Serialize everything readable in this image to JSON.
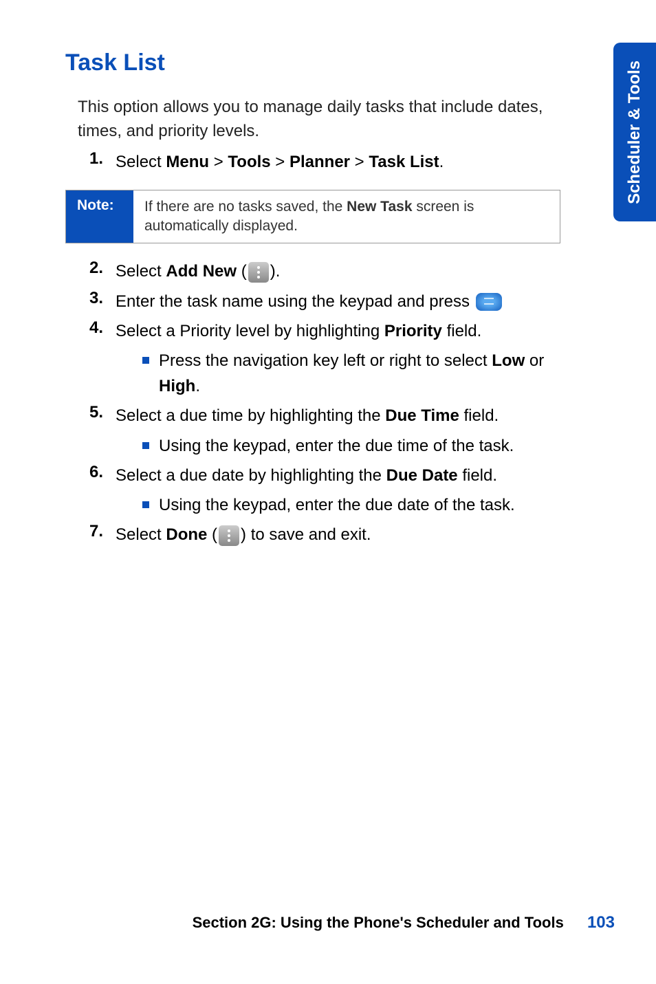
{
  "side_tab": "Scheduler & Tools",
  "heading": "Task List",
  "intro": "This option allows you to manage daily tasks that include dates, times, and priority levels.",
  "step1": {
    "num": "1.",
    "prefix": "Select ",
    "path": [
      "Menu",
      "Tools",
      "Planner",
      "Task List"
    ],
    "sep": " > ",
    "suffix": "."
  },
  "note": {
    "label": "Note:",
    "prefix": "If there are no tasks saved, the ",
    "bold": "New Task",
    "suffix": " screen is automatically displayed."
  },
  "step2": {
    "num": "2.",
    "prefix": "Select ",
    "bold": "Add New",
    "open": " (",
    "close": ")."
  },
  "step3": {
    "num": "3.",
    "text": "Enter the task name using the keypad and press "
  },
  "step4": {
    "num": "4.",
    "prefix": "Select a Priority level by highlighting ",
    "bold": "Priority",
    "suffix": " field.",
    "sub_prefix": "Press the navigation key left or right to select ",
    "sub_bold1": "Low",
    "sub_mid": " or ",
    "sub_bold2": "High",
    "sub_end": "."
  },
  "step5": {
    "num": "5.",
    "prefix": "Select a due time by highlighting the ",
    "bold": "Due Time",
    "suffix": " field.",
    "sub": "Using the keypad, enter the due time of the task."
  },
  "step6": {
    "num": "6.",
    "prefix": "Select a due date by highlighting the ",
    "bold": "Due Date",
    "suffix": " field.",
    "sub": "Using the keypad, enter the due date of the task."
  },
  "step7": {
    "num": "7.",
    "prefix": "Select ",
    "bold": "Done",
    "open": " (",
    "close": ") to save and exit."
  },
  "footer": {
    "section": "Section 2G: Using the Phone's Scheduler and Tools",
    "page": "103"
  }
}
